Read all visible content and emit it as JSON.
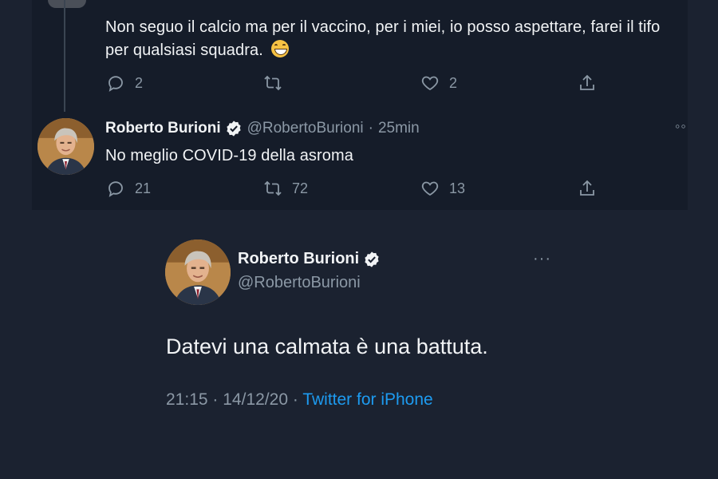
{
  "reply_tweet": {
    "text": "Non seguo il calcio ma per il vaccino, per i miei,  io posso aspettare,  farei il tifo per qualsiasi squadra.",
    "emoji": "grinning-face-emoji",
    "replies": "2",
    "retweets": "",
    "likes": "2"
  },
  "burioni_tweet": {
    "name": "Roberto Burioni",
    "handle": "@RobertoBurioni",
    "separator": "·",
    "time": "25min",
    "text": "No meglio COVID-19 della asroma",
    "replies": "21",
    "retweets": "72",
    "likes": "13",
    "more": "◦◦"
  },
  "detail_tweet": {
    "name": "Roberto Burioni",
    "handle": "@RobertoBurioni",
    "text": "Datevi una calmata è una battuta.",
    "time": "21:15",
    "date": "14/12/20",
    "separator": "·",
    "source": "Twitter for iPhone",
    "more": "···"
  },
  "colors": {
    "background": "#1b2230",
    "panel": "#151c29",
    "accent": "#1d9bf0",
    "muted": "#8b98a5",
    "text": "#f1f3f5"
  }
}
